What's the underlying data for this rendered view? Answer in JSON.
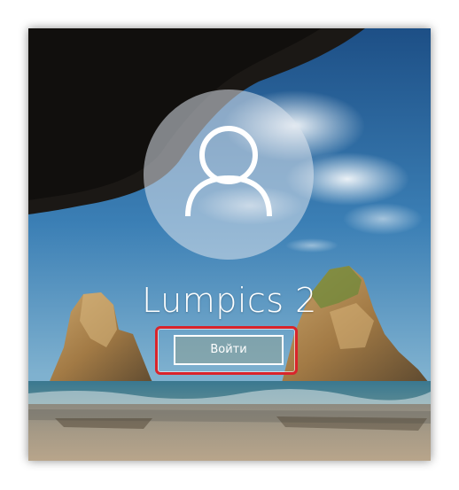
{
  "lock_screen": {
    "user_name": "Lumpics 2",
    "signin_label": "Войти",
    "avatar_icon": "user-icon",
    "highlight_color": "#d9242b"
  }
}
